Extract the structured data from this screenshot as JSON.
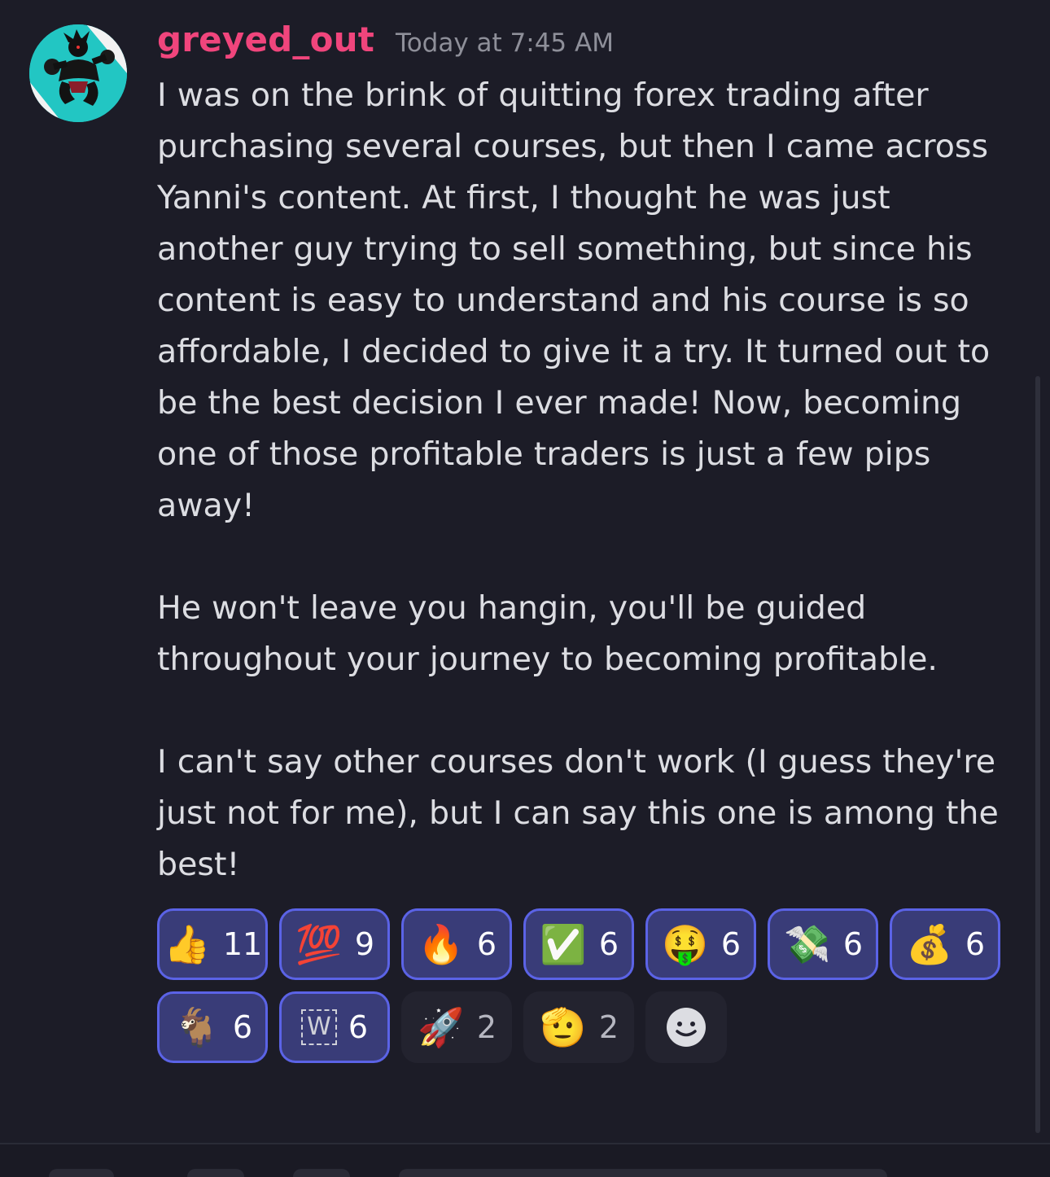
{
  "message": {
    "username": "greyed_out",
    "timestamp": "Today at 7:45 AM",
    "paragraphs": [
      "I was on the brink of quitting forex trading after purchasing several courses, but then I came across Yanni's content. At first, I thought he was just another guy trying to sell something, but since his content is easy to understand and his course is so affordable, I decided to give it a try. It turned out to be the best decision I ever made! Now, becoming one of those profitable traders is just a few pips away!",
      "He won't leave you hangin, you'll be guided throughout your journey to becoming profitable.",
      "I can't say other courses don't work (I guess they're just not for me), but I can say this one is among the best!"
    ]
  },
  "reactions": [
    {
      "emoji": "👍",
      "icon": "thumbs-up-icon",
      "count": "11",
      "active": true
    },
    {
      "emoji": "💯",
      "icon": "hundred-points-icon",
      "count": "9",
      "active": true
    },
    {
      "emoji": "🔥",
      "icon": "fire-icon",
      "count": "6",
      "active": true
    },
    {
      "emoji": "✅",
      "icon": "check-mark-icon",
      "count": "6",
      "active": true
    },
    {
      "emoji": "🤑",
      "icon": "money-mouth-face-icon",
      "count": "6",
      "active": true
    },
    {
      "emoji": "💸",
      "icon": "money-with-wings-icon",
      "count": "6",
      "active": true
    },
    {
      "emoji": "💰",
      "icon": "money-bag-icon",
      "count": "6",
      "active": true
    },
    {
      "emoji": "🐐",
      "icon": "goat-icon",
      "count": "6",
      "active": true
    },
    {
      "emoji": "W",
      "icon": "w-custom-emoji-icon",
      "count": "6",
      "active": true
    },
    {
      "emoji": "🚀",
      "icon": "rocket-icon",
      "count": "2",
      "active": false
    },
    {
      "emoji": "🫡",
      "icon": "saluting-face-icon",
      "count": "2",
      "active": false
    }
  ],
  "colors": {
    "background": "#1c1c27",
    "username": "#f0457c",
    "timestamp": "#8e8f99",
    "text": "#dcdde2",
    "reaction_active_bg": "#393c78",
    "reaction_active_border": "#5b63e6",
    "reaction_inactive_bg": "#23232f"
  }
}
